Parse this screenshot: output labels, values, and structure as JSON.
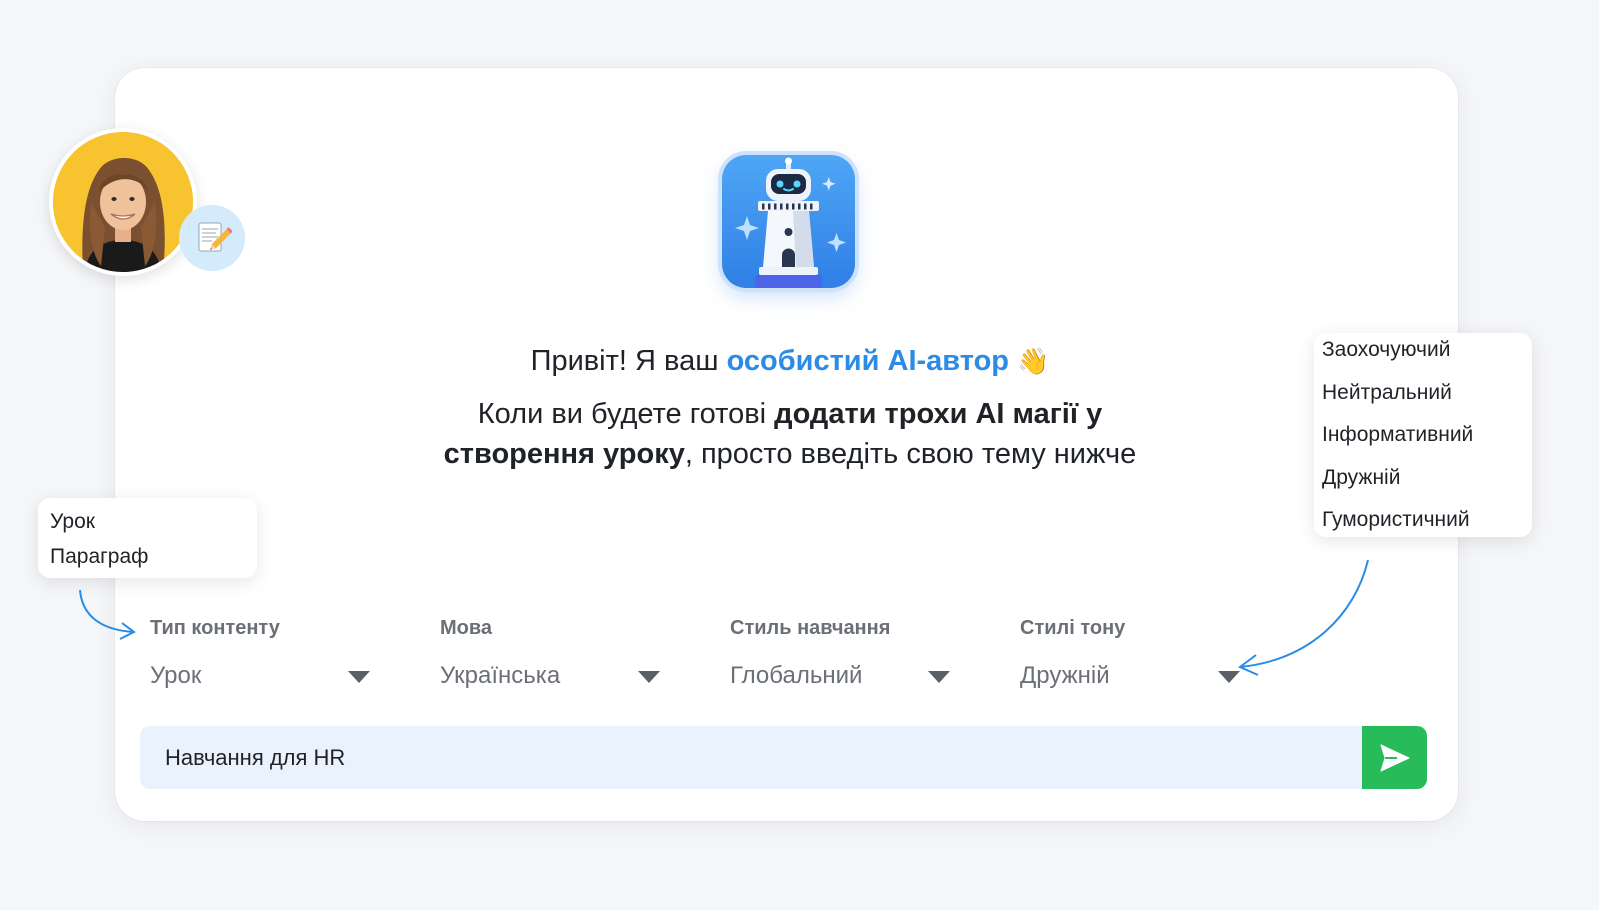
{
  "greeting": {
    "prefix": "Привіт! Я ваш ",
    "accent": "особистий AI-автор",
    "wave": "👋"
  },
  "intro": {
    "part1": "Коли ви будете готові ",
    "bold1": "додати трохи AI магії у",
    "bold2": "створення уроку",
    "part2": ", просто введіть свою тему нижче"
  },
  "content_type_options": [
    "Урок",
    "Параграф"
  ],
  "tone_options": [
    "Заохочуючий",
    "Нейтральний",
    "Інформативний",
    "Дружній",
    "Гумористичний"
  ],
  "fields": [
    {
      "label": "Тип контенту",
      "value": "Урок"
    },
    {
      "label": "Мова",
      "value": "Українська"
    },
    {
      "label": "Стиль навчання",
      "value": "Глобальний"
    },
    {
      "label": "Стилі тону",
      "value": "Дружній"
    }
  ],
  "topic_input": {
    "value": "Навчання для HR"
  },
  "icons": {
    "mascot": "lighthouse-robot-icon",
    "note": "memo-pencil-icon",
    "send": "send-arrow-icon",
    "dropdown": "caret-down-icon"
  },
  "colors": {
    "accent": "#2b8be6",
    "send_button": "#27bb5a",
    "avatar_background": "#f7c430",
    "input_background": "#eaf2fd"
  }
}
